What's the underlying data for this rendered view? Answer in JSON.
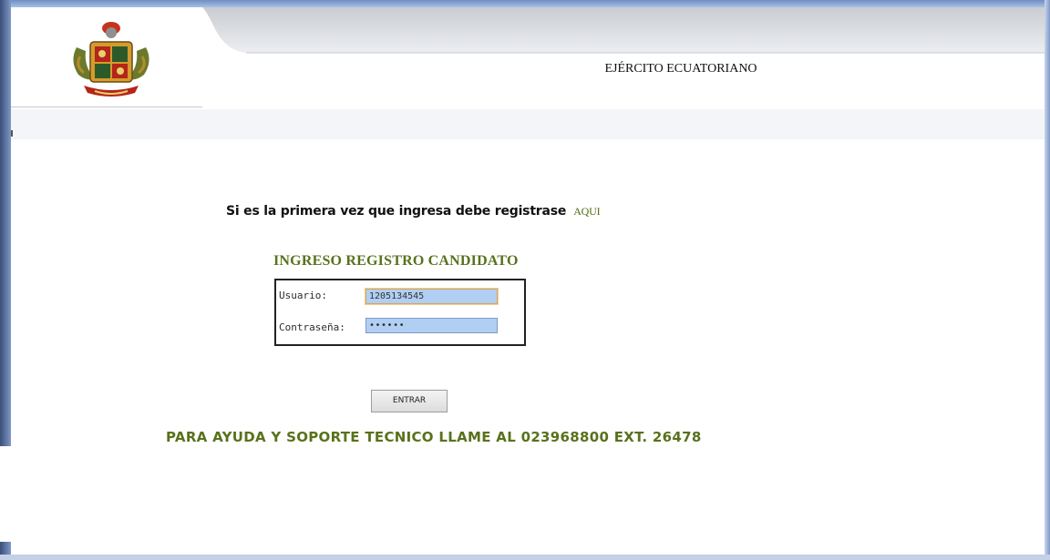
{
  "header": {
    "organization": "EJÉRCITO ECUATORIANO",
    "logo": "coat-of-arms-emblem"
  },
  "intro": {
    "text": "Si es la primera vez que ingresa debe registrase",
    "link_label": "AQUI"
  },
  "login_form": {
    "title": "INGRESO REGISTRO CANDIDATO",
    "username_label": "Usuario:",
    "username_value": "1205134545",
    "password_label": "Contraseña:",
    "password_mask": "••••••"
  },
  "submit_label": "ENTRAR",
  "help_text": "PARA AYUDA Y SOPORTE TECNICO LLAME AL 023968800 EXT. 26478",
  "colors": {
    "accent_green": "#58721c",
    "input_fill": "#b0cff3",
    "frame_blue": "#5f7cb0"
  }
}
